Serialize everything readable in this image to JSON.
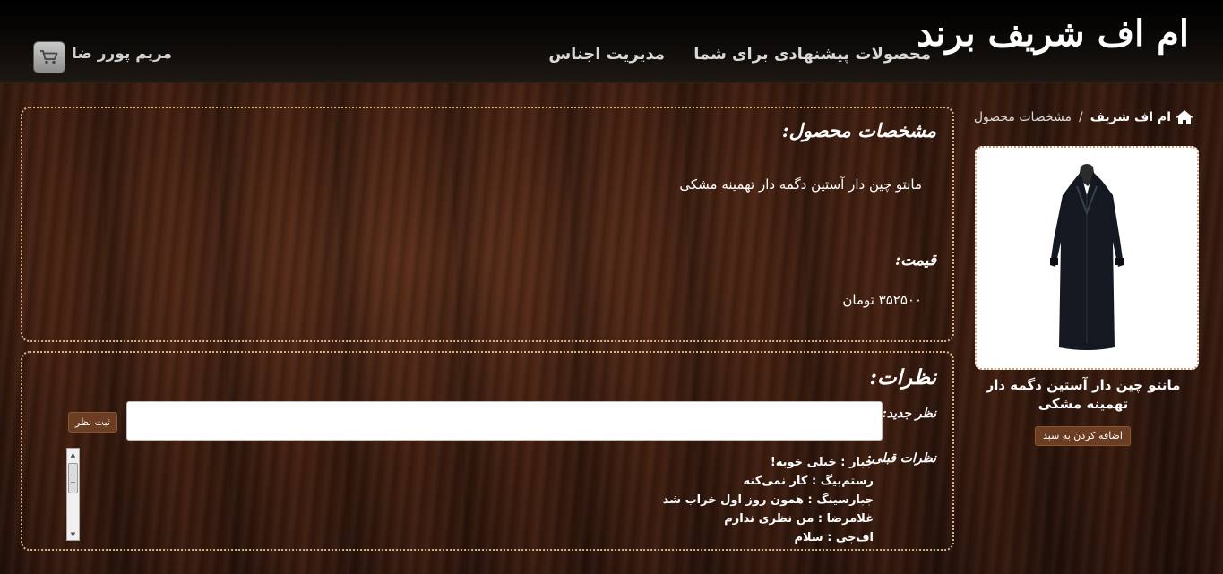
{
  "header": {
    "brand": "ام اف شریف برند",
    "nav": {
      "suggested_products": "محصولات پیشنهادی برای شما",
      "manage_products": "مدیریت اجناس"
    },
    "user": {
      "name": "مریم پورر ضا",
      "cart_icon": "shopping-cart-icon"
    }
  },
  "breadcrumb": {
    "home_icon": "home-icon",
    "home": "ام اف شریف",
    "separator": "/",
    "current": "مشخصات محصول"
  },
  "product_card": {
    "image_alt": "black-manteau-image",
    "title": "مانتو چین دار آستین دگمه دار تهمینه مشکی",
    "add_to_cart": "اضافه کردن به سبد"
  },
  "specs": {
    "title": "مشخصات محصول:",
    "product_name": "مانتو چین دار آستین دگمه دار تهمینه مشکی",
    "price_label": "قیمت:",
    "price_value": "۳۵۲۵۰۰ تومان"
  },
  "comments": {
    "title": "نظرات:",
    "new_label": "نظر جدید:",
    "input_value": "",
    "submit": "ثبت نظر",
    "previous_label": "نظرات قبلی:",
    "items": [
      "جبار : خیلی خوبه!",
      "رستم‌بیگ : کار نمی‌کنه",
      "جبارسینگ : همون روز اول خراب شد",
      "غلامرضا : من نظری ندارم",
      "اف‌جی : سلام"
    ]
  },
  "colors": {
    "button_bg": "#6b3d22",
    "panel_border": "#d9b28a",
    "header_bg": "#000000"
  }
}
